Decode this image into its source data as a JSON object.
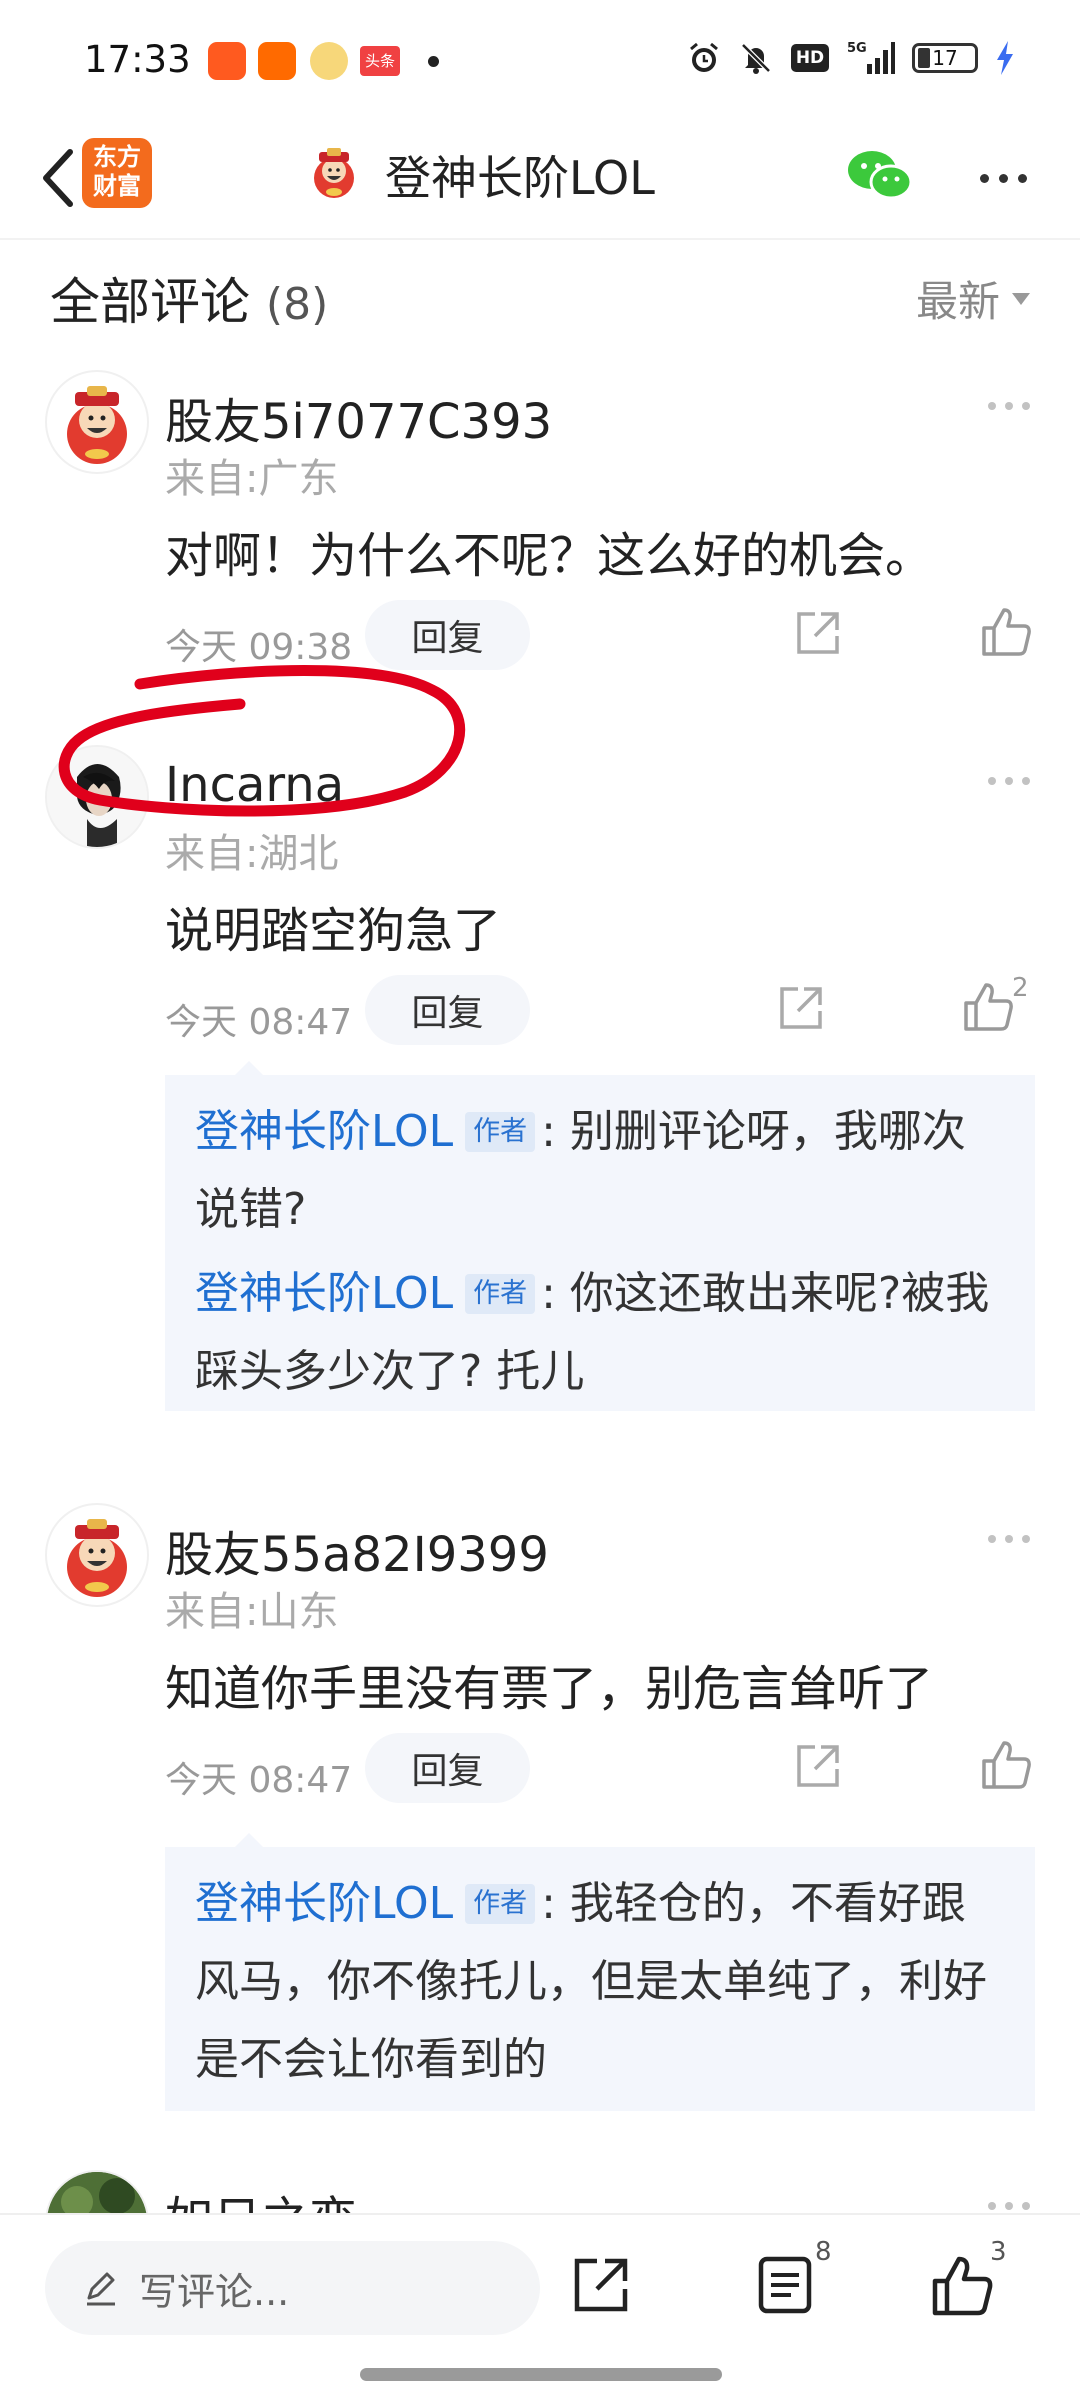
{
  "status_bar": {
    "time": "17:33",
    "app_icons": [
      "kuaishou-app-icon",
      "1688-app-icon",
      "caishen-app-icon",
      "toutiao-app-icon"
    ],
    "app_icon_toutiao_text": "头条",
    "network": "5G",
    "hd_label": "HD",
    "battery": "17"
  },
  "header": {
    "logo_line1": "东方",
    "logo_line2": "财富",
    "title": "登神长阶LOL"
  },
  "comments_section": {
    "title": "全部评论",
    "count": "(8)",
    "sort_label": "最新"
  },
  "comments": [
    {
      "username": "股友5i7077C393",
      "location": "来自:广东",
      "text": "对啊！为什么不呢？这么好的机会。",
      "time": "今天 09:38",
      "reply_label": "回复",
      "likes": ""
    },
    {
      "username": "Incarna",
      "location": "来自:湖北",
      "text": "说明踏空狗急了",
      "time": "今天 08:47",
      "reply_label": "回复",
      "likes": "2",
      "replies": [
        {
          "author": "登神长阶LOL",
          "tag": "作者",
          "text": ": 别删评论呀，我哪次说错?"
        },
        {
          "author": "登神长阶LOL",
          "tag": "作者",
          "text": ": 你这还敢出来呢?被我踩头多少次了? 托儿"
        }
      ]
    },
    {
      "username": "股友55a82I9399",
      "location": "来自:山东",
      "text": "知道你手里没有票了，别危言耸听了",
      "time": "今天 08:47",
      "reply_label": "回复",
      "likes": "",
      "replies": [
        {
          "author": "登神长阶LOL",
          "tag": "作者",
          "text": ": 我轻仓的，不看好跟风马，你不像托儿，但是太单纯了，利好是不会让你看到的"
        }
      ]
    },
    {
      "username": "如日之恋"
    }
  ],
  "bottom_bar": {
    "write_placeholder": "写评论...",
    "comments_badge": "8",
    "likes_badge": "3"
  },
  "colors": {
    "brand_orange": "#f36b1d",
    "author_blue": "#1f6fd1",
    "annotation_red": "#e0001b",
    "reply_bg": "#f3f6fc"
  }
}
